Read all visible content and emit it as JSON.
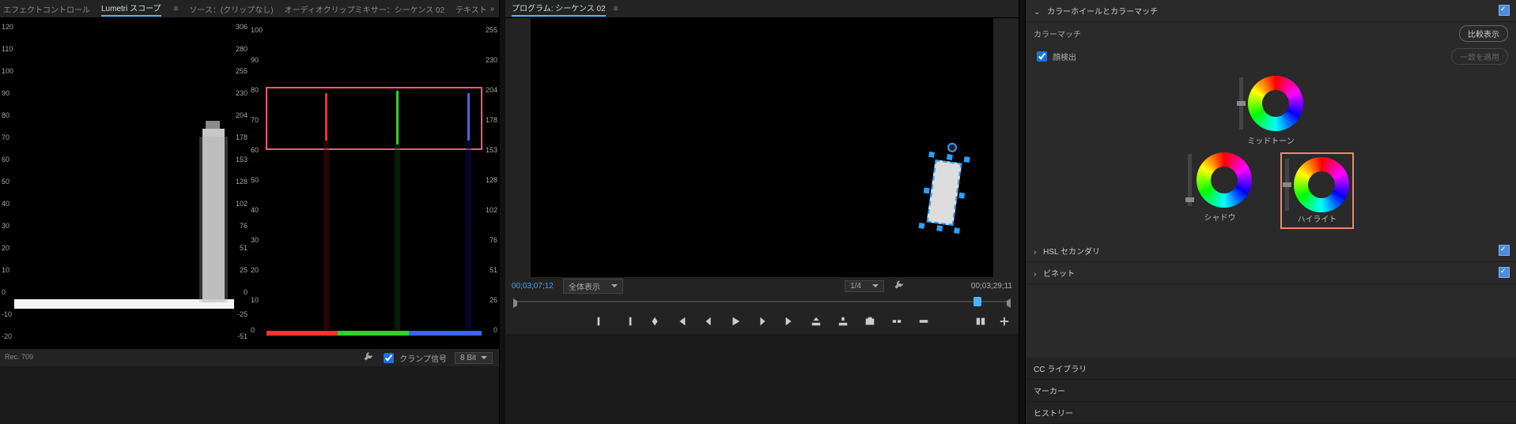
{
  "top_tabs": {
    "effect_controls": "エフェクトコントロール",
    "lumetri_scopes": "Lumetri スコープ",
    "source": "ソース：(クリップなし)",
    "audio_mixer": "オーディオクリップミキサー：シーケンス 02",
    "text": "テキスト",
    "menu_glyph": "≡",
    "overflow": "»"
  },
  "luma_axis": {
    "ticks": [
      "120",
      "110",
      "100",
      "90",
      "80",
      "70",
      "60",
      "50",
      "40",
      "30",
      "20",
      "10",
      "0",
      "-10",
      "-20"
    ],
    "ticks_r": [
      "306",
      "280",
      "255",
      "230",
      "204",
      "178",
      "153",
      "128",
      "102",
      "76",
      "51",
      "25",
      "0",
      "-25",
      "-51"
    ]
  },
  "rgb_axis": {
    "ticks_l": [
      "100",
      "90",
      "80",
      "70",
      "60",
      "50",
      "40",
      "30",
      "20",
      "10",
      "0"
    ],
    "ticks_r": [
      "255",
      "230",
      "204",
      "178",
      "153",
      "128",
      "102",
      "76",
      "51",
      "26",
      "0"
    ]
  },
  "scope_footer": {
    "rec": "Rec. 709",
    "clamp": "クランプ信号",
    "bit": "8 Bit"
  },
  "program": {
    "tab": "プログラム: シーケンス 02",
    "menu_glyph": "≡",
    "tc_in": "00;03;07;12",
    "fit": "全体表示",
    "res": "1/4",
    "duration": "00;03;29;11"
  },
  "lumetri": {
    "wheels_section": "カラーホイールとカラーマッチ",
    "color_match": "カラーマッチ",
    "compare": "比較表示",
    "face_detect": "顔検出",
    "apply_match": "一致を適用",
    "mid": "ミッドトーン",
    "shadow": "シャドウ",
    "highlight": "ハイライト",
    "hsl": "HSL セカンダリ",
    "vignette": "ビネット"
  },
  "bottom_tabs": {
    "cc": "CC ライブラリ",
    "marker": "マーカー",
    "history": "ヒストリー"
  }
}
